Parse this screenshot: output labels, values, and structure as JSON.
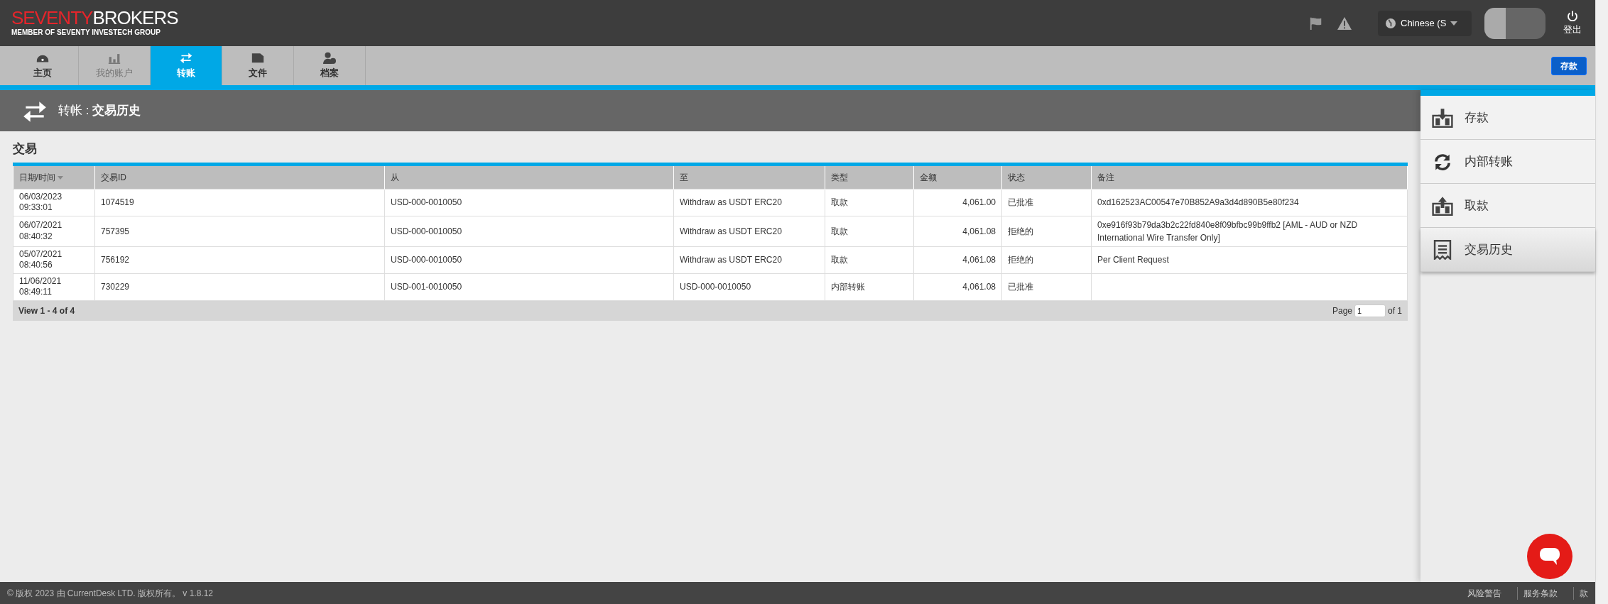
{
  "header": {
    "logo": {
      "part_red": "SEVENTY",
      "part_white": "BROKERS",
      "tagline": "MEMBER OF SEVENTY INVESTECH GROUP"
    },
    "language": "Chinese (S",
    "logout": "登出"
  },
  "nav_tabs": [
    {
      "label": "主页",
      "selected": false,
      "disabled": false
    },
    {
      "label": "我的账户",
      "selected": false,
      "disabled": true
    },
    {
      "label": "转账",
      "selected": true,
      "disabled": false
    },
    {
      "label": "文件",
      "selected": false,
      "disabled": false
    },
    {
      "label": "档案",
      "selected": false,
      "disabled": false
    }
  ],
  "deposit_button": "存款",
  "page_title": {
    "section": "转帐",
    "separator": ":",
    "title": "交易历史"
  },
  "table": {
    "title": "交易",
    "columns": [
      "日期/时间",
      "交易ID",
      "从",
      "至",
      "类型",
      "金额",
      "状态",
      "备注"
    ],
    "rows": [
      {
        "date": "06/03/2023",
        "time": "09:33:01",
        "id": "1074519",
        "from": "USD-000-0010050",
        "to": "Withdraw as USDT ERC20",
        "type": "取款",
        "amount": "4,061.00",
        "status": "已批准",
        "note": "0xd162523AC00547e70B852A9a3d4d890B5e80f234"
      },
      {
        "date": "06/07/2021",
        "time": "08:40:32",
        "id": "757395",
        "from": "USD-000-0010050",
        "to": "Withdraw as USDT ERC20",
        "type": "取款",
        "amount": "4,061.08",
        "status": "拒绝的",
        "note": "0xe916f93b79da3b2c22fd840e8f09bfbc99b9ffb2 [AML - AUD or NZD International Wire Transfer Only]"
      },
      {
        "date": "05/07/2021",
        "time": "08:40:56",
        "id": "756192",
        "from": "USD-000-0010050",
        "to": "Withdraw as USDT ERC20",
        "type": "取款",
        "amount": "4,061.08",
        "status": "拒绝的",
        "note": "Per Client Request"
      },
      {
        "date": "11/06/2021",
        "time": "08:49:11",
        "id": "730229",
        "from": "USD-001-0010050",
        "to": "USD-000-0010050",
        "type": "内部转账",
        "amount": "4,061.08",
        "status": "已批准"
      }
    ],
    "view_info": "View 1 - 4 of 4",
    "page_label": "Page",
    "page_value": "1",
    "page_of": "of 1"
  },
  "sidebar": {
    "items": [
      {
        "label": "存款",
        "selected": false
      },
      {
        "label": "内部转账",
        "selected": false
      },
      {
        "label": "取款",
        "selected": false
      },
      {
        "label": "交易历史",
        "selected": true
      }
    ]
  },
  "footer": {
    "copyright": "© 版权 2023 由 CurrentDesk LTD. 版权所有。 v 1.8.12",
    "links": [
      "风险警告",
      "服务条款",
      "款"
    ]
  }
}
